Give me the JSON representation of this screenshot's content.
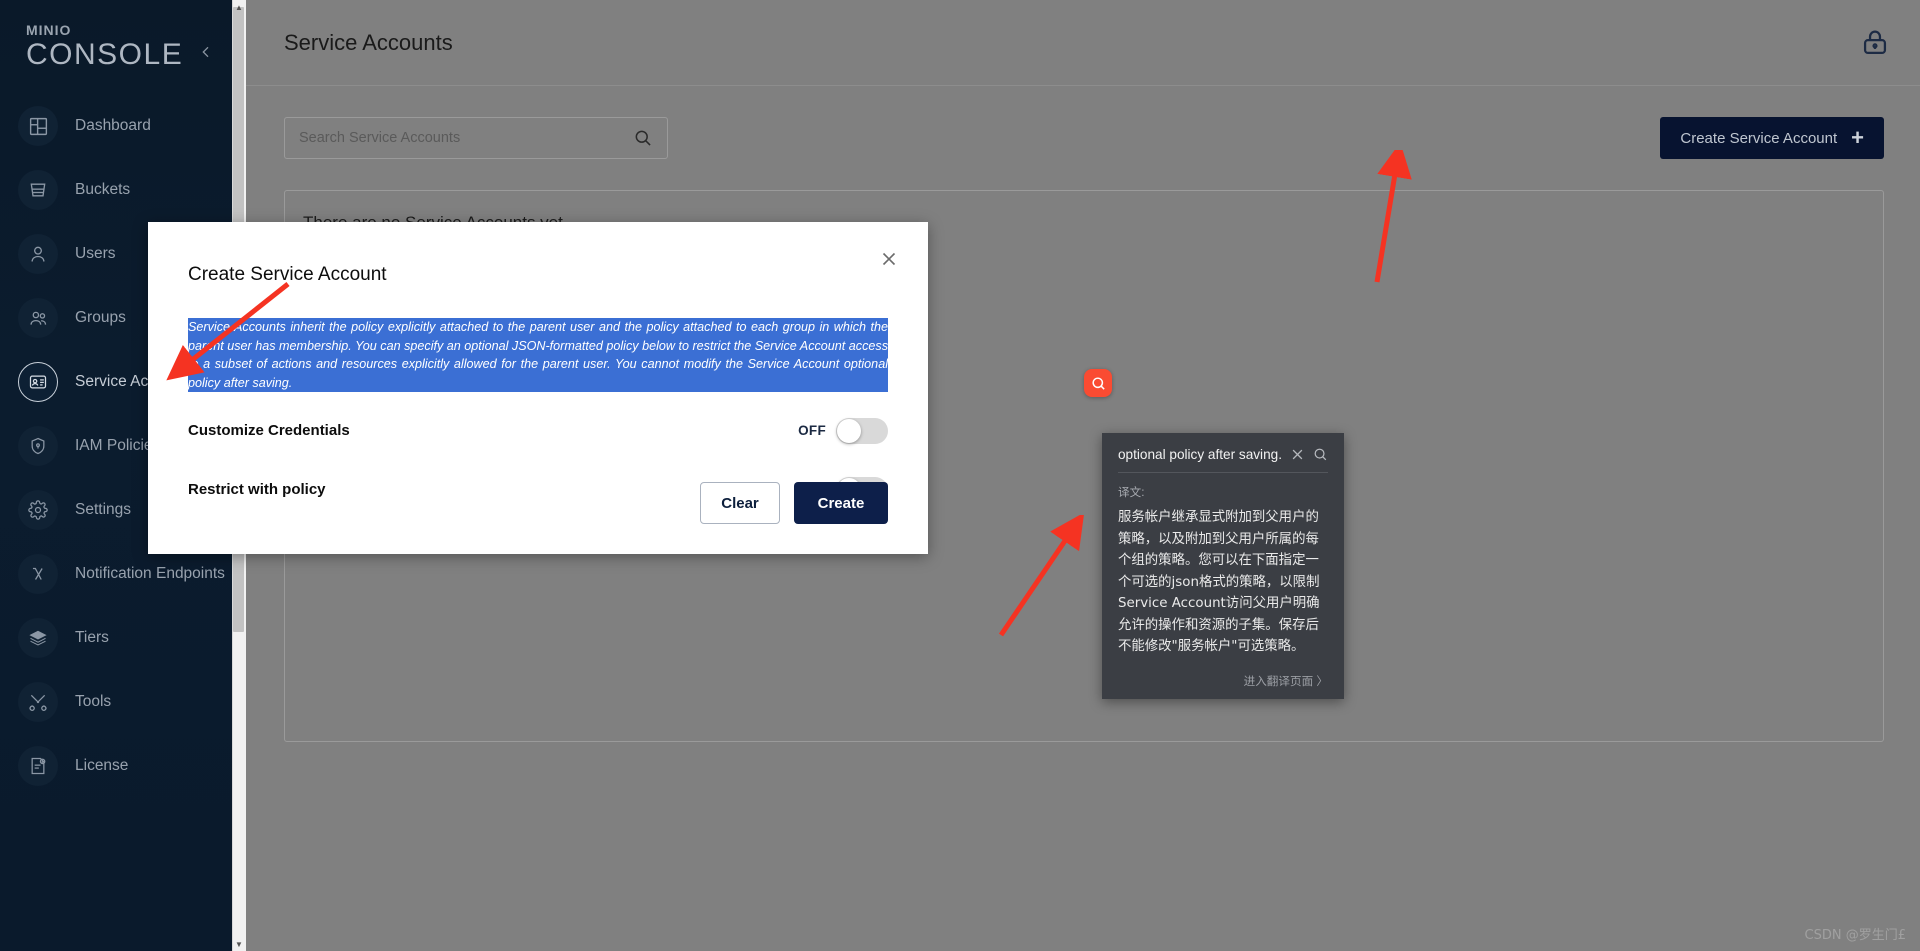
{
  "sidebar": {
    "brand_top": "MINIO",
    "brand_bottom": "CONSOLE",
    "collapse_icon": "chevron-left-icon",
    "items": [
      {
        "label": "Dashboard",
        "icon": "dashboard-icon",
        "active": false
      },
      {
        "label": "Buckets",
        "icon": "bucket-icon",
        "active": false
      },
      {
        "label": "Users",
        "icon": "user-icon",
        "active": false
      },
      {
        "label": "Groups",
        "icon": "groups-icon",
        "active": false
      },
      {
        "label": "Service Accounts",
        "icon": "id-card-icon",
        "active": true
      },
      {
        "label": "IAM Policies",
        "icon": "shield-icon",
        "active": false
      },
      {
        "label": "Settings",
        "icon": "gear-icon",
        "active": false
      },
      {
        "label": "Notification Endpoints",
        "icon": "lambda-icon",
        "active": false
      },
      {
        "label": "Tiers",
        "icon": "layers-icon",
        "active": false
      },
      {
        "label": "Tools",
        "icon": "tools-icon",
        "active": false
      },
      {
        "label": "License",
        "icon": "license-icon",
        "active": false
      }
    ]
  },
  "header": {
    "title": "Service Accounts",
    "lock_icon": "lock-icon"
  },
  "toolbar": {
    "search_placeholder": "Search Service Accounts",
    "search_value": "",
    "search_icon": "search-icon",
    "create_button_label": "Create Service Account",
    "create_button_plus": "+"
  },
  "content": {
    "empty_message": "There are no Service Accounts yet."
  },
  "modal": {
    "title": "Create Service Account",
    "close_icon": "close-icon",
    "policy_note": "Service Accounts inherit the policy explicitly attached to the parent user and the policy attached to each group in which the parent user has membership. You can specify an optional JSON-formatted policy below to restrict the Service Account access to a subset of actions and resources explicitly allowed for the parent user. You cannot modify the Service Account optional policy after saving.",
    "rows": [
      {
        "label": "Customize Credentials",
        "state": "OFF"
      },
      {
        "label": "Restrict with policy",
        "state": "OFF"
      }
    ],
    "clear_label": "Clear",
    "create_label": "Create"
  },
  "translate_trigger": {
    "icon": "search-circle-icon",
    "color": "#fa4b32"
  },
  "translate_popup": {
    "phrase": "optional policy after saving.",
    "close_icon": "close-icon",
    "search_icon": "search-icon",
    "section_label": "译文:",
    "body": "服务帐户继承显式附加到父用户的策略，以及附加到父用户所属的每个组的策略。您可以在下面指定一个可选的json格式的策略，以限制Service Account访问父用户明确允许的操作和资源的子集。保存后不能修改\"服务帐户\"可选策略。",
    "footer_link": "进入翻译页面 〉"
  },
  "watermark": {
    "text": "CSDN @罗生门£"
  },
  "colors": {
    "sidebar_bg": "#0a1929",
    "accent_dark": "#0d1f4a",
    "highlight_blue": "#3b6fd4",
    "translate_orange": "#fa4b32",
    "arrow_red": "#f53322"
  }
}
